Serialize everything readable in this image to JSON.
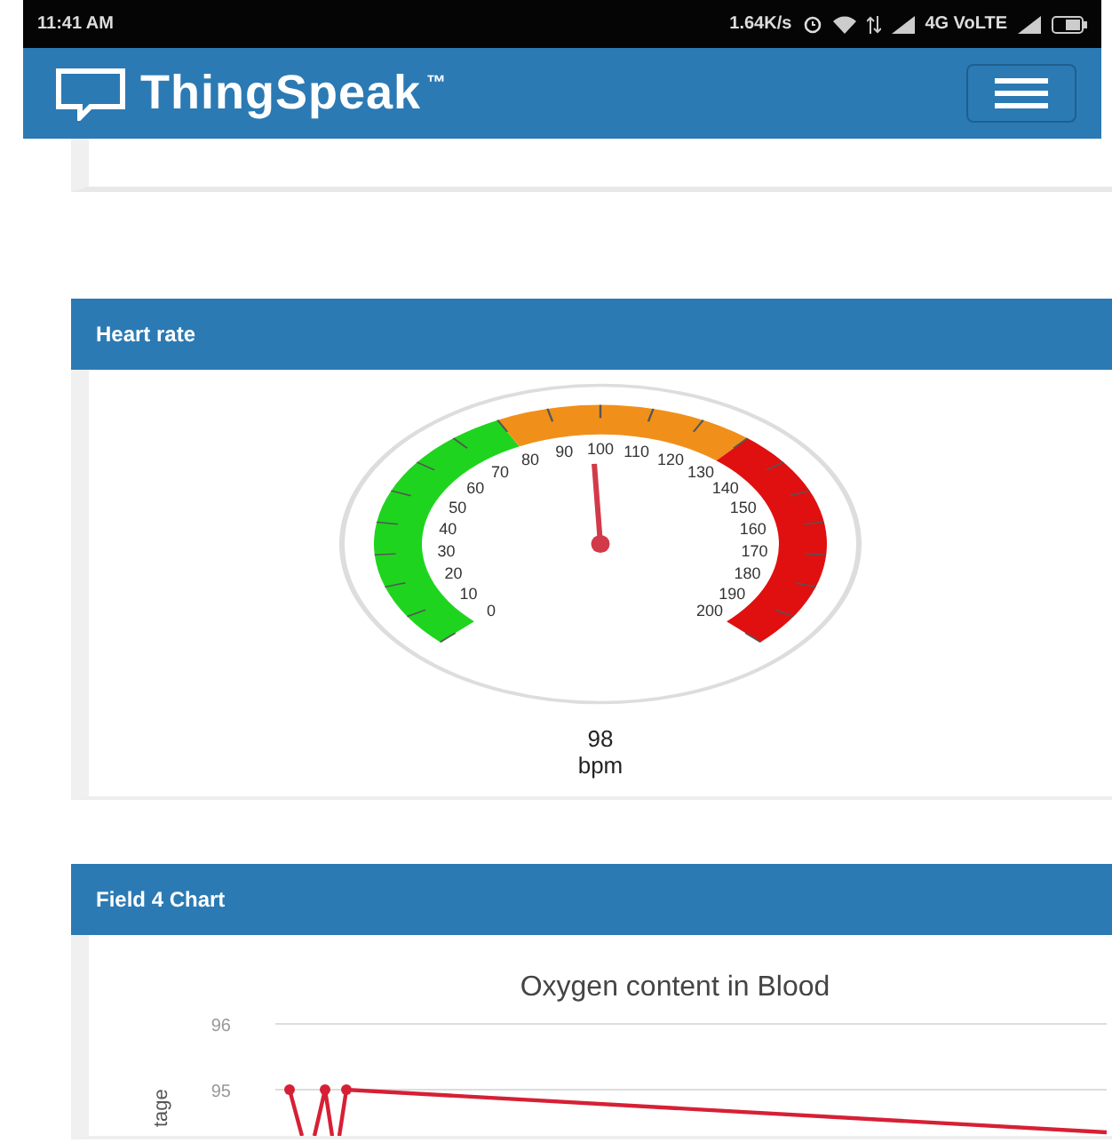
{
  "status_bar": {
    "time": "11:41 AM",
    "speed": "1.64K/s",
    "network": "4G VoLTE"
  },
  "header": {
    "brand": "ThingSpeak",
    "trademark": "™"
  },
  "panels": [
    {
      "kind": "gauge",
      "title": "Heart rate",
      "gauge": {
        "left_tick_labels": [
          "80",
          "70",
          "60",
          "50",
          "40",
          "30",
          "20",
          "10",
          "0"
        ],
        "top_tick_labels": [
          "90",
          "100",
          "110",
          "120"
        ],
        "right_tick_labels": [
          "130",
          "140",
          "150",
          "160",
          "170",
          "180",
          "190",
          "200"
        ],
        "value": "98",
        "unit": "bpm"
      }
    },
    {
      "kind": "chart",
      "title": "Field 4 Chart",
      "chart": {
        "title": "Oxygen content in Blood",
        "ylabel": "tage",
        "y_tick_labels": [
          "96",
          "95"
        ]
      }
    }
  ]
}
